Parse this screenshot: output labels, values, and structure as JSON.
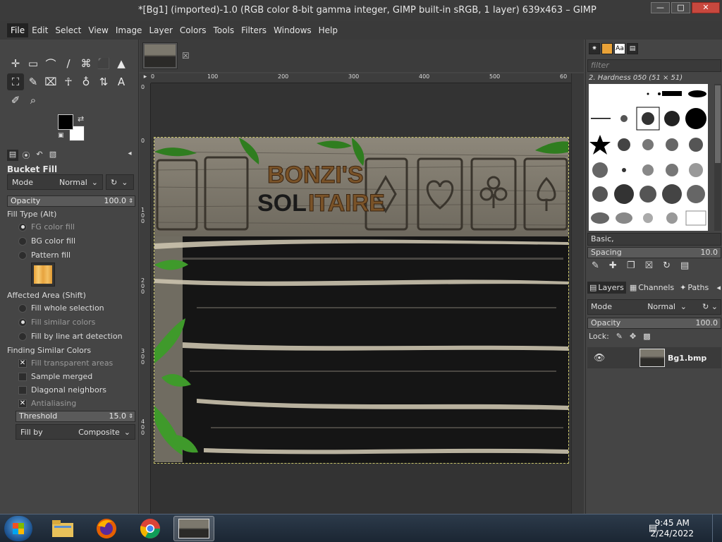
{
  "window": {
    "title": "*[Bg1] (imported)-1.0 (RGB color 8-bit gamma integer, GIMP built-in sRGB, 1 layer) 639x463 – GIMP",
    "minimize": "—",
    "maximize": "□",
    "close": "✕"
  },
  "menubar": [
    "File",
    "Edit",
    "Select",
    "View",
    "Image",
    "Layer",
    "Colors",
    "Tools",
    "Filters",
    "Windows",
    "Help"
  ],
  "toolbox": {
    "tools": [
      "✛",
      "▭",
      "⌒",
      "∕",
      "⌘",
      "⬛",
      "▲",
      "⛶",
      "✎",
      "⌧",
      "☥",
      "♁",
      "⇅",
      "A",
      "✐",
      "⌕"
    ],
    "swap_glyph": "⇄"
  },
  "tool_options": {
    "name": "Bucket Fill",
    "mode_label": "Mode",
    "mode_value": "Normal",
    "opacity_label": "Opacity",
    "opacity_value": "100.0",
    "fill_type_label": "Fill Type  (Alt)",
    "fill_types": [
      "FG color fill",
      "BG color fill",
      "Pattern fill"
    ],
    "affected_area_label": "Affected Area  (Shift)",
    "affected_areas": [
      "Fill whole selection",
      "Fill similar colors",
      "Fill by line art detection"
    ],
    "finding_label": "Finding Similar Colors",
    "checks": [
      "Fill transparent areas",
      "Sample merged",
      "Diagonal neighbors",
      "Antialiasing"
    ],
    "threshold_label": "Threshold",
    "threshold_value": "15.0",
    "fillby_label": "Fill by",
    "fillby_value": "Composite"
  },
  "rulers": {
    "h_ticks": [
      "0",
      "100",
      "200",
      "300",
      "400",
      "500",
      "60"
    ],
    "v_ticks": [
      "0",
      "100",
      "200",
      "300",
      "400"
    ]
  },
  "image_text": {
    "line1": "BONZI'S",
    "line2_dark": "SOL",
    "line2_light": "ITAIRE"
  },
  "brushes": {
    "filter_placeholder": "filter",
    "current": "2. Hardness 050 (51 × 51)",
    "tag": "Basic,",
    "spacing_label": "Spacing",
    "spacing_value": "10.0"
  },
  "layers": {
    "tabs": [
      "Layers",
      "Channels",
      "Paths"
    ],
    "mode_label": "Mode",
    "mode_value": "Normal",
    "opacity_label": "Opacity",
    "opacity_value": "100.0",
    "lock_label": "Lock:",
    "layer_name": "Bg1.bmp"
  },
  "taskbar": {
    "time": "9:45 AM",
    "date": "2/24/2022"
  },
  "colors": {
    "accent_selection": "#c8c46a",
    "fg_color": "#000000",
    "bg_color": "#ffffff"
  }
}
